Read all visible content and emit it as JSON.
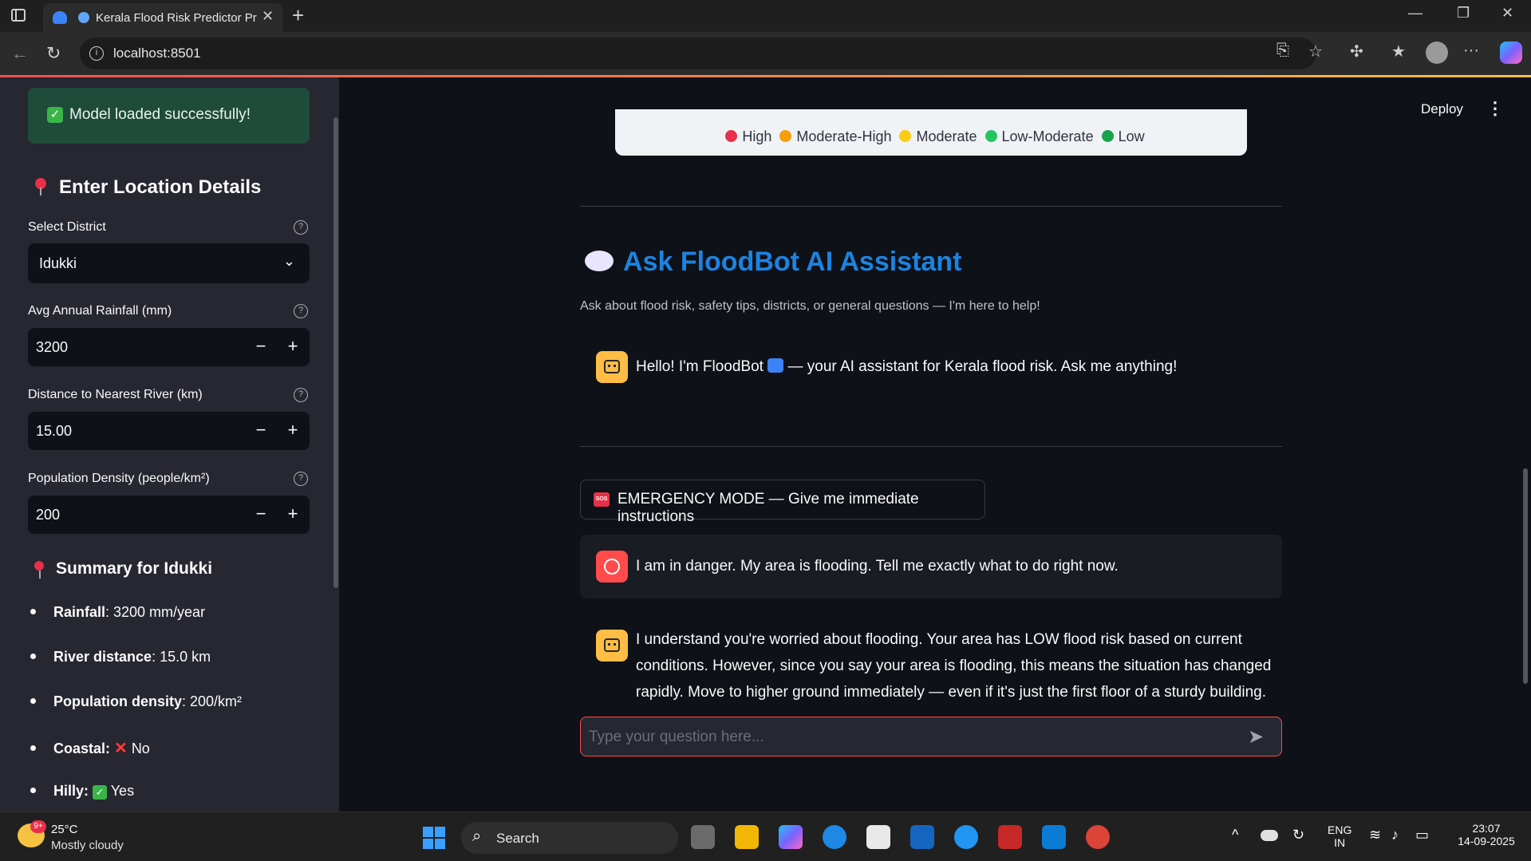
{
  "browser": {
    "tab_title": "Kerala Flood Risk Predictor Pr",
    "url": "localhost:8501"
  },
  "sidebar": {
    "success_message": "Model loaded successfully!",
    "location_heading": "Enter Location Details",
    "district": {
      "label": "Select District",
      "value": "Idukki"
    },
    "rainfall": {
      "label": "Avg Annual Rainfall (mm)",
      "value": "3200"
    },
    "river_distance": {
      "label": "Distance to Nearest River (km)",
      "value": "15.00"
    },
    "population": {
      "label": "Population Density (people/km²)",
      "value": "200"
    },
    "summary_heading": "Summary for Idukki",
    "summary": [
      {
        "key": "Rainfall",
        "value": ": 3200 mm/year"
      },
      {
        "key": "River distance",
        "value": ": 15.0 km"
      },
      {
        "key": "Population density",
        "value": ": 200/km²"
      },
      {
        "key": "Coastal",
        "value": "No"
      },
      {
        "key": "Hilly",
        "value": "Yes"
      }
    ]
  },
  "header": {
    "deploy_label": "Deploy"
  },
  "legend": {
    "items": [
      {
        "label": "High",
        "color": "#e8304a"
      },
      {
        "label": "Moderate-High",
        "color": "#f59e0b"
      },
      {
        "label": "Moderate",
        "color": "#facc15"
      },
      {
        "label": "Low-Moderate",
        "color": "#22c55e"
      },
      {
        "label": "Low",
        "color": "#16a34a"
      }
    ]
  },
  "chat": {
    "title": "Ask FloodBot AI Assistant",
    "subtitle": "Ask about flood risk, safety tips, districts, or general questions — I'm here to help!",
    "greeting_part1": "Hello! I'm FloodBot",
    "greeting_part2": "— your AI assistant for Kerala flood risk. Ask me anything!",
    "emergency_button": "EMERGENCY MODE — Give me immediate instructions",
    "sos_badge": "SOS",
    "user_message": "I am in danger. My area is flooding. Tell me exactly what to do right now.",
    "bot_reply": "I understand you're worried about flooding. Your area has LOW flood risk based on current conditions. However, since you say your area is flooding, this means the situation has changed rapidly. Move to higher ground immediately — even if it's just the first floor of a sturdy building. If",
    "input_placeholder": "Type your question here..."
  },
  "taskbar": {
    "weather_badge": "9+",
    "temperature": "25°C",
    "weather": "Mostly cloudy",
    "search_label": "Search",
    "lang_top": "ENG",
    "lang_bottom": "IN",
    "time": "23:07",
    "date": "14-09-2025"
  }
}
